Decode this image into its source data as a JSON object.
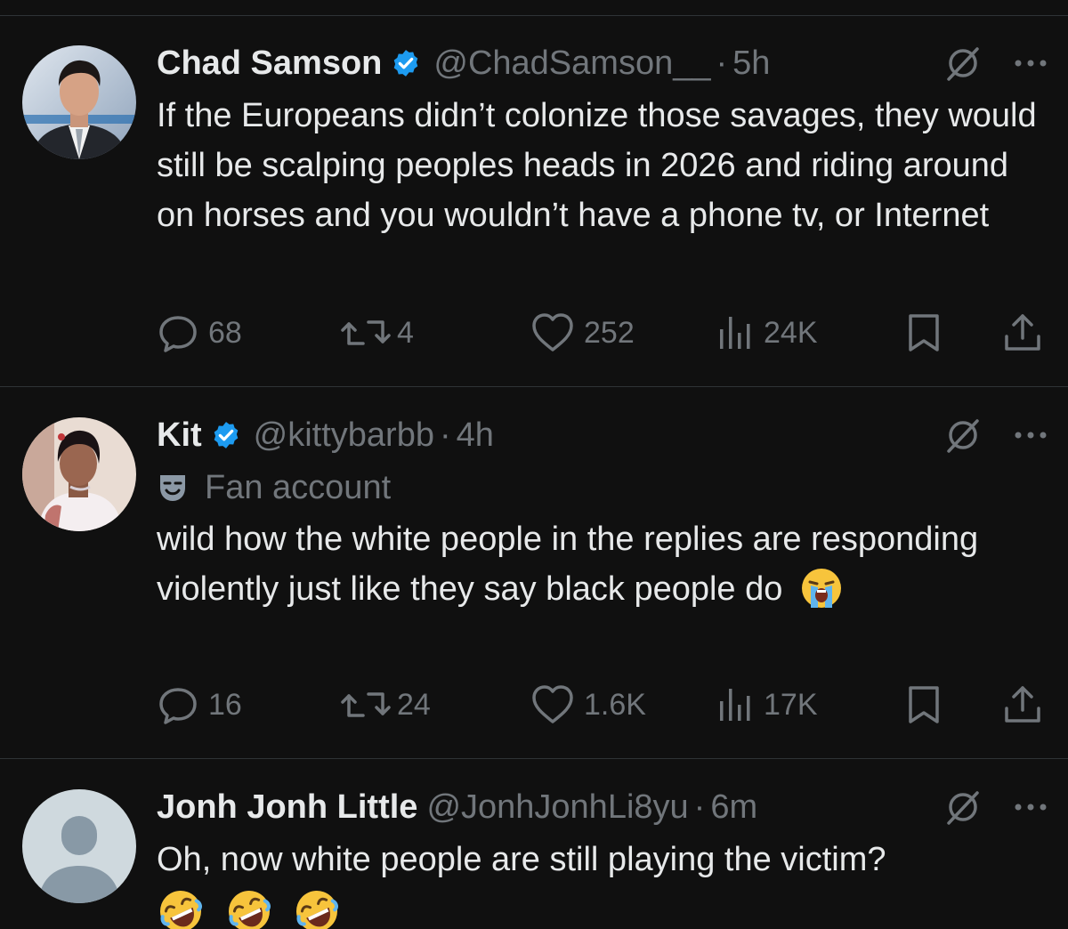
{
  "tweets": [
    {
      "name": "Chad Samson",
      "handle": "@ChadSamson__",
      "time": "5h",
      "text": "If the Europeans didn’t colonize those savages, they would still be scalping peoples heads in 2026 and riding around on horses and you wouldn’t have a phone tv, or Internet",
      "replies": "68",
      "reposts": "4",
      "likes": "252",
      "views": "24K",
      "verified": true,
      "avatar_icon": "avatar-photo-man-suit"
    },
    {
      "name": "Kit",
      "handle": "@kittybarbb",
      "time": "4h",
      "label": "Fan account",
      "label_icon": "theater-mask-icon",
      "text": "wild how the white people in the replies are responding violently just like they say black people do",
      "text_emoji": "loudly-crying-face-icon",
      "replies": "16",
      "reposts": "24",
      "likes": "1.6K",
      "views": "17K",
      "verified": true,
      "avatar_icon": "avatar-photo-woman"
    },
    {
      "name": "Jonh Jonh Little",
      "handle": "@JonhJonhLi8yu",
      "time": "6m",
      "text": "Oh, now white people are still playing the victim?",
      "text_emoji": "rolling-on-floor-laughing-icon",
      "verified": false,
      "avatar_icon": "default-avatar-icon"
    }
  ],
  "dot": "·",
  "colors": {
    "background": "#101010",
    "text": "#e7e9ea",
    "muted": "#71767b",
    "verified_blue": "#1d9bf0",
    "divider": "#2f3336"
  }
}
